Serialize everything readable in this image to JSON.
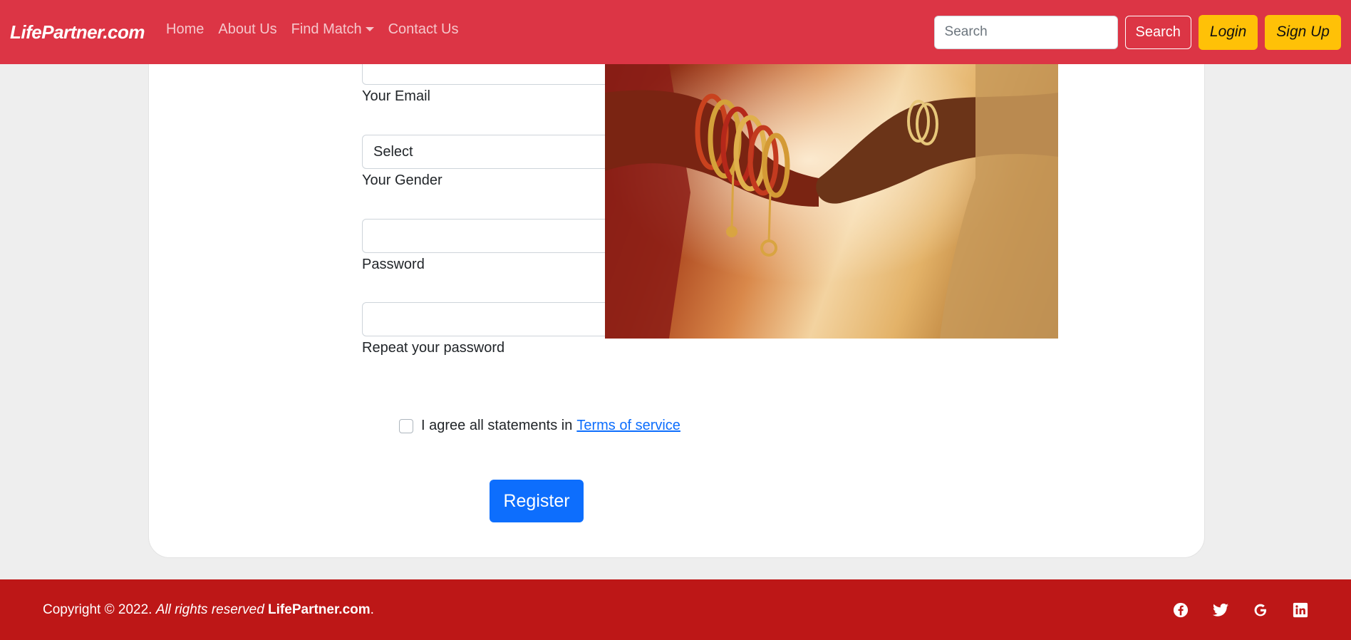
{
  "navbar": {
    "brand": "LifePartner.com",
    "links": [
      "Home",
      "About Us",
      "Find Match",
      "Contact Us"
    ],
    "search_placeholder": "Search",
    "search_button": "Search",
    "login_button": "Login",
    "signup_button": "Sign Up"
  },
  "form": {
    "email_label": "Your Email",
    "gender_select_value": "Select",
    "gender_label": "Your Gender",
    "password_label": "Password",
    "repeat_password_label": "Repeat your password",
    "agree_text": "I agree all statements in",
    "terms_link": "Terms of service",
    "register_button": "Register"
  },
  "footer": {
    "copyright_prefix": "Copyright © 2022.",
    "rights_text": "All rights reserved",
    "brand": "LifePartner.com",
    "period": ".",
    "social_icons": [
      "facebook-icon",
      "twitter-icon",
      "google-icon",
      "linkedin-icon"
    ]
  },
  "colors": {
    "navbar": "#dc3545",
    "footer": "#bd1717",
    "accent_yellow": "#ffc107",
    "primary_blue": "#0d6efd"
  }
}
